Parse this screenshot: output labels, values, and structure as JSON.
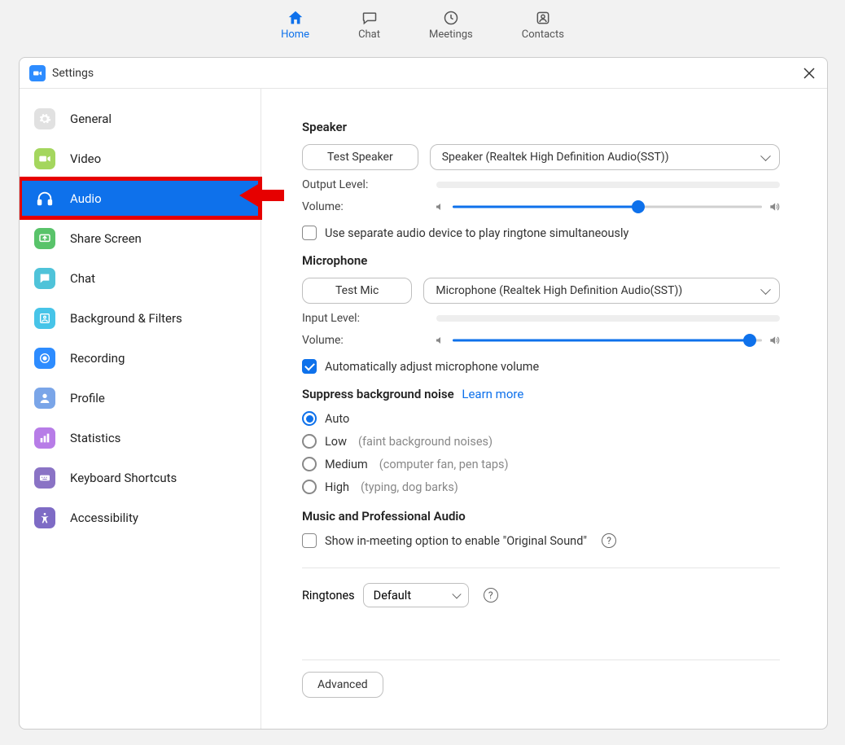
{
  "topnav": {
    "home": "Home",
    "chat": "Chat",
    "meetings": "Meetings",
    "contacts": "Contacts"
  },
  "window": {
    "title": "Settings"
  },
  "sidebar": {
    "items": [
      {
        "label": "General"
      },
      {
        "label": "Video"
      },
      {
        "label": "Audio"
      },
      {
        "label": "Share Screen"
      },
      {
        "label": "Chat"
      },
      {
        "label": "Background & Filters"
      },
      {
        "label": "Recording"
      },
      {
        "label": "Profile"
      },
      {
        "label": "Statistics"
      },
      {
        "label": "Keyboard Shortcuts"
      },
      {
        "label": "Accessibility"
      }
    ]
  },
  "audio": {
    "speaker_heading": "Speaker",
    "test_speaker_btn": "Test Speaker",
    "speaker_device": "Speaker (Realtek High Definition Audio(SST))",
    "output_level_label": "Output Level:",
    "volume_label": "Volume:",
    "speaker_volume_pct": 60,
    "separate_ringtone": "Use separate audio device to play ringtone simultaneously",
    "mic_heading": "Microphone",
    "test_mic_btn": "Test Mic",
    "mic_device": "Microphone (Realtek High Definition Audio(SST))",
    "input_level_label": "Input Level:",
    "mic_volume_pct": 96,
    "auto_adjust": "Automatically adjust microphone volume",
    "suppress_heading": "Suppress background noise",
    "learn_more": "Learn more",
    "noise_options": [
      {
        "label": "Auto",
        "hint": ""
      },
      {
        "label": "Low",
        "hint": "(faint background noises)"
      },
      {
        "label": "Medium",
        "hint": "(computer fan, pen taps)"
      },
      {
        "label": "High",
        "hint": "(typing, dog barks)"
      }
    ],
    "music_heading": "Music and Professional Audio",
    "original_sound": "Show in-meeting option to enable \"Original Sound\"",
    "ringtones_label": "Ringtones",
    "ringtones_value": "Default",
    "advanced_btn": "Advanced"
  }
}
